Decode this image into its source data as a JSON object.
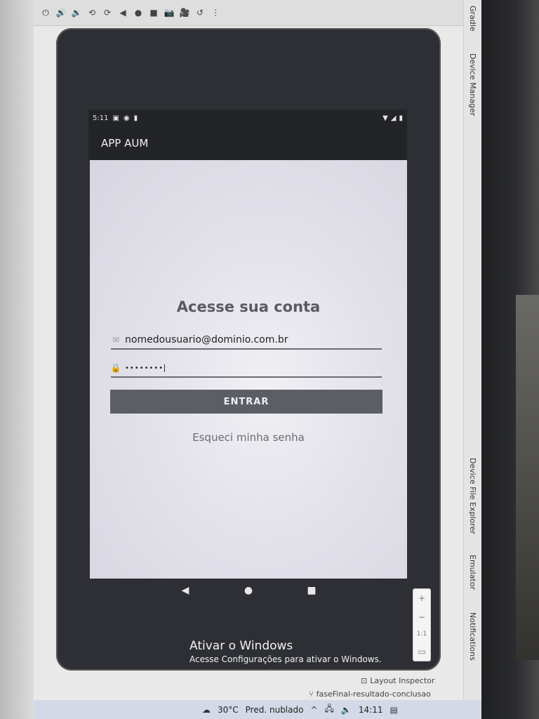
{
  "ide": {
    "toolbar_icons": [
      "power-icon",
      "volume-up-icon",
      "volume-down-icon",
      "rotate-icon",
      "rotate-alt-icon",
      "back-icon",
      "home-icon",
      "overview-icon",
      "camera-icon",
      "video-icon",
      "history-icon",
      "more-icon"
    ],
    "side_tabs": {
      "gradle": "Gradle",
      "device_manager": "Device Manager",
      "device_file_explorer": "Device File Explorer",
      "emulator": "Emulator",
      "notifications": "Notifications"
    },
    "zoom": {
      "plus": "+",
      "minus": "−",
      "ratio": "1:1"
    },
    "bottom": {
      "layout_inspector": "Layout Inspector",
      "branch": "faseFinal-resultado-conclusao"
    }
  },
  "device": {
    "status_time": "5:11",
    "app_title": "APP AUM",
    "login": {
      "heading": "Acesse sua conta",
      "email_value": "nomedousuario@dominio.com.br",
      "password_value": "••••••••",
      "submit_label": "ENTRAR",
      "forgot_label": "Esqueci minha senha"
    },
    "nav": {
      "back": "◀",
      "home": "●",
      "recents": "■"
    }
  },
  "watermark": {
    "title": "Ativar o Windows",
    "subtitle": "Acesse Configurações para ativar o Windows."
  },
  "taskbar": {
    "weather_temp": "30°C",
    "weather_text": "Pred. nublado",
    "clock": "14:11"
  }
}
